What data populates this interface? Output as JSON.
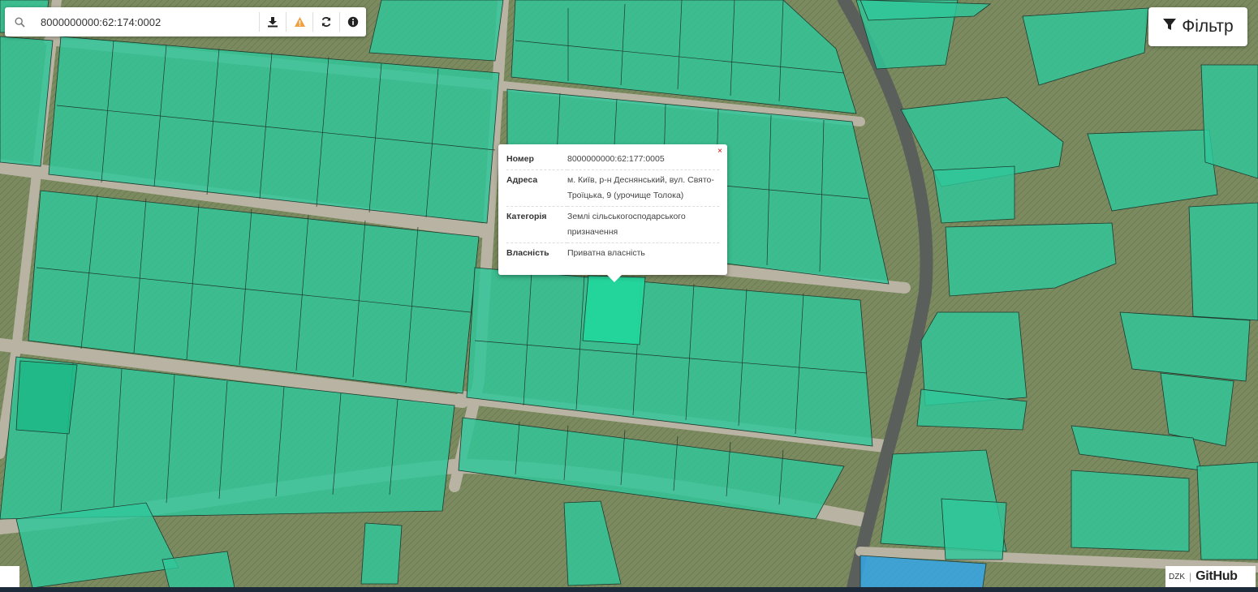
{
  "search": {
    "value": "8000000000:62:174:0002",
    "icon": "search-icon"
  },
  "toolbar": {
    "download_icon": "download-icon",
    "warning_icon": "warning-icon",
    "refresh_icon": "refresh-icon",
    "info_icon": "info-icon",
    "warning_color": "#f0a040"
  },
  "filter": {
    "label": "Фільтр",
    "icon": "funnel-icon"
  },
  "popup": {
    "close_label": "×",
    "rows": [
      {
        "key": "Номер",
        "value": "8000000000:62:177:0005"
      },
      {
        "key": "Адреса",
        "value": "м. Київ, р-н Деснянський, вул. Свято-Троїцька, 9 (урочище Толока)"
      },
      {
        "key": "Категорія",
        "value": "Землі сільськогосподарського призначення"
      },
      {
        "key": "Власність",
        "value": "Приватна власність"
      }
    ]
  },
  "attribution": {
    "dzk": "DZK",
    "github": "GitHub"
  },
  "colors": {
    "parcel_fill": "#2ec79a",
    "parcel_selected": "#22d69c",
    "parcel_blue": "#35a6e6",
    "parcel_stroke": "#1d3a2e"
  }
}
